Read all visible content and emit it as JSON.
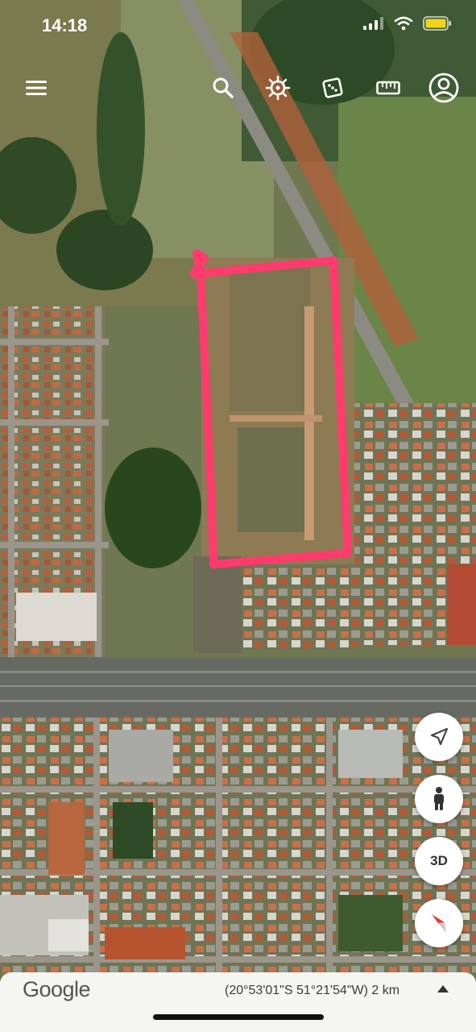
{
  "status_bar": {
    "time": "14:18",
    "icons": [
      "cellular-signal-icon",
      "wifi-icon",
      "battery-icon"
    ],
    "battery_color": "#f2d21b"
  },
  "toolbar": {
    "icons": [
      "menu-icon",
      "search-icon",
      "voyager-icon",
      "feeling-lucky-icon",
      "measure-icon",
      "account-icon"
    ]
  },
  "map": {
    "type": "satellite",
    "highlight_color": "#ff3b6e"
  },
  "floating_controls": {
    "my_location": "my-location-icon",
    "street_view": "street-view-icon",
    "view_3d_label": "3D",
    "compass": "compass-icon"
  },
  "bottom_bar": {
    "logo": "Google",
    "coordinates": "(20°53'01\"S 51°21'54\"W) 2 km",
    "expand": "chevron-up-icon"
  }
}
